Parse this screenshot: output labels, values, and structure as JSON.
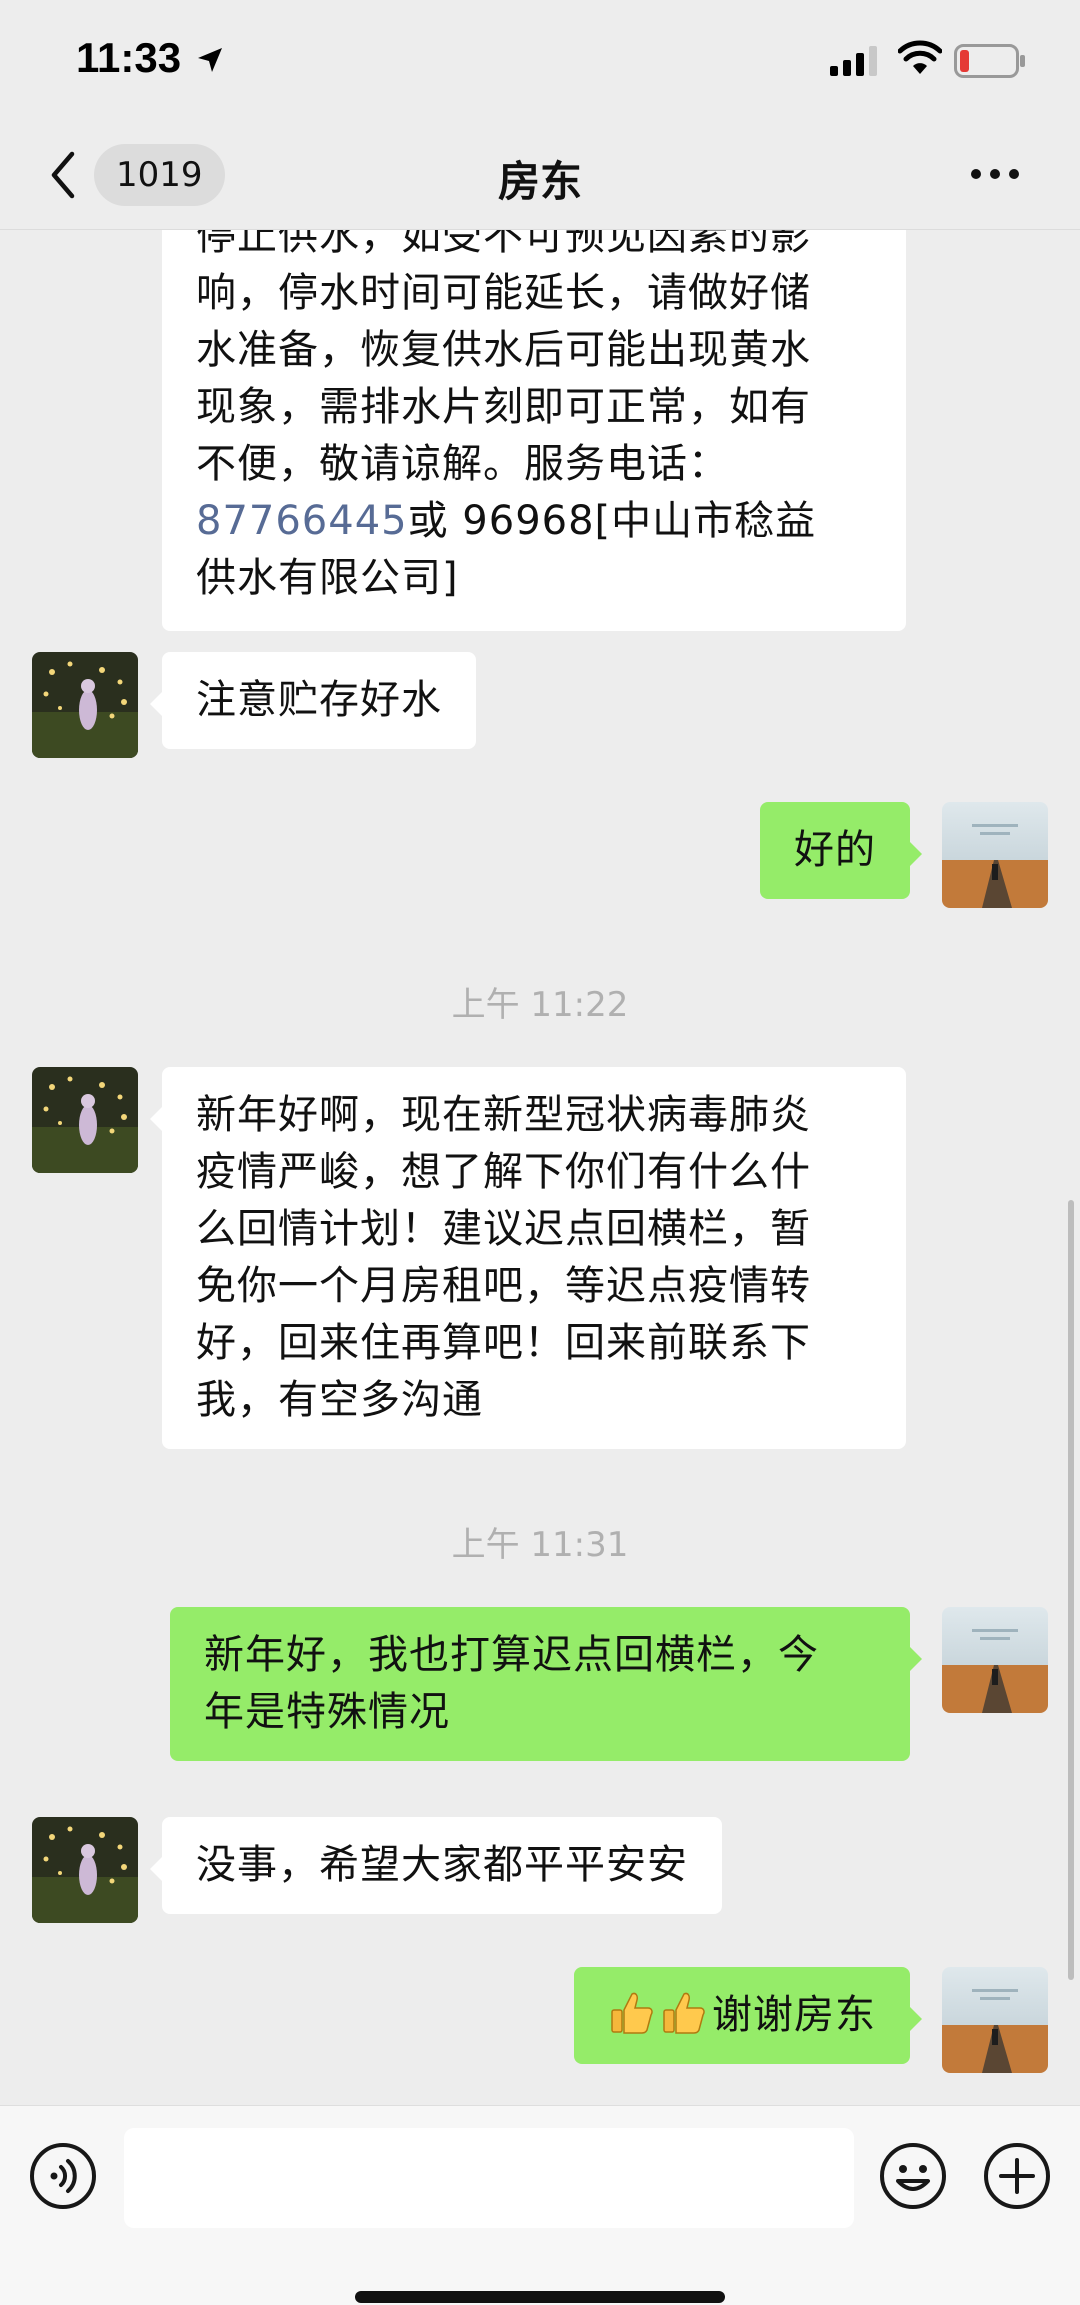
{
  "status_bar": {
    "time": "11:33"
  },
  "nav": {
    "unread_count": "1019",
    "title": "房东"
  },
  "messages": [
    {
      "from": "landlord",
      "lines": [
        "停止供水，如受不可预见因素的影",
        "响，停水时间可能延长，请做好储",
        "水准备，恢复供水后可能出现黄水",
        "现象，需排水片刻即可正常，如有",
        "不便，敬请谅解。服务电话："
      ],
      "phone": "87766445",
      "after_phone": "或 96968[中山市稔益",
      "last_line": "供水有限公司]"
    },
    {
      "from": "landlord",
      "text": "注意贮存好水"
    },
    {
      "from": "me",
      "text": "好的"
    },
    {
      "timestamp": "上午 11:22"
    },
    {
      "from": "landlord",
      "lines": [
        "新年好啊，现在新型冠状病毒肺炎",
        "疫情严峻，想了解下你们有什么什",
        "么回情计划！建议迟点回横栏，暂",
        "免你一个月房租吧，等迟点疫情转",
        "好，回来住再算吧！回来前联系下",
        "我，有空多沟通"
      ]
    },
    {
      "timestamp": "上午 11:31"
    },
    {
      "from": "me",
      "lines": [
        "新年好，我也打算迟点回横栏，今",
        "年是特殊情况"
      ]
    },
    {
      "from": "landlord",
      "text": "没事，希望大家都平平安安"
    },
    {
      "from": "me",
      "text": "谢谢房东",
      "prefix_emoji": "thumbs-up x2"
    }
  ],
  "colors": {
    "bg": "#ededed",
    "bubble_in": "#ffffff",
    "bubble_out": "#95ec69",
    "link": "#576b95",
    "timestamp": "#b0b0b0"
  },
  "input_bar": {
    "placeholder": ""
  }
}
